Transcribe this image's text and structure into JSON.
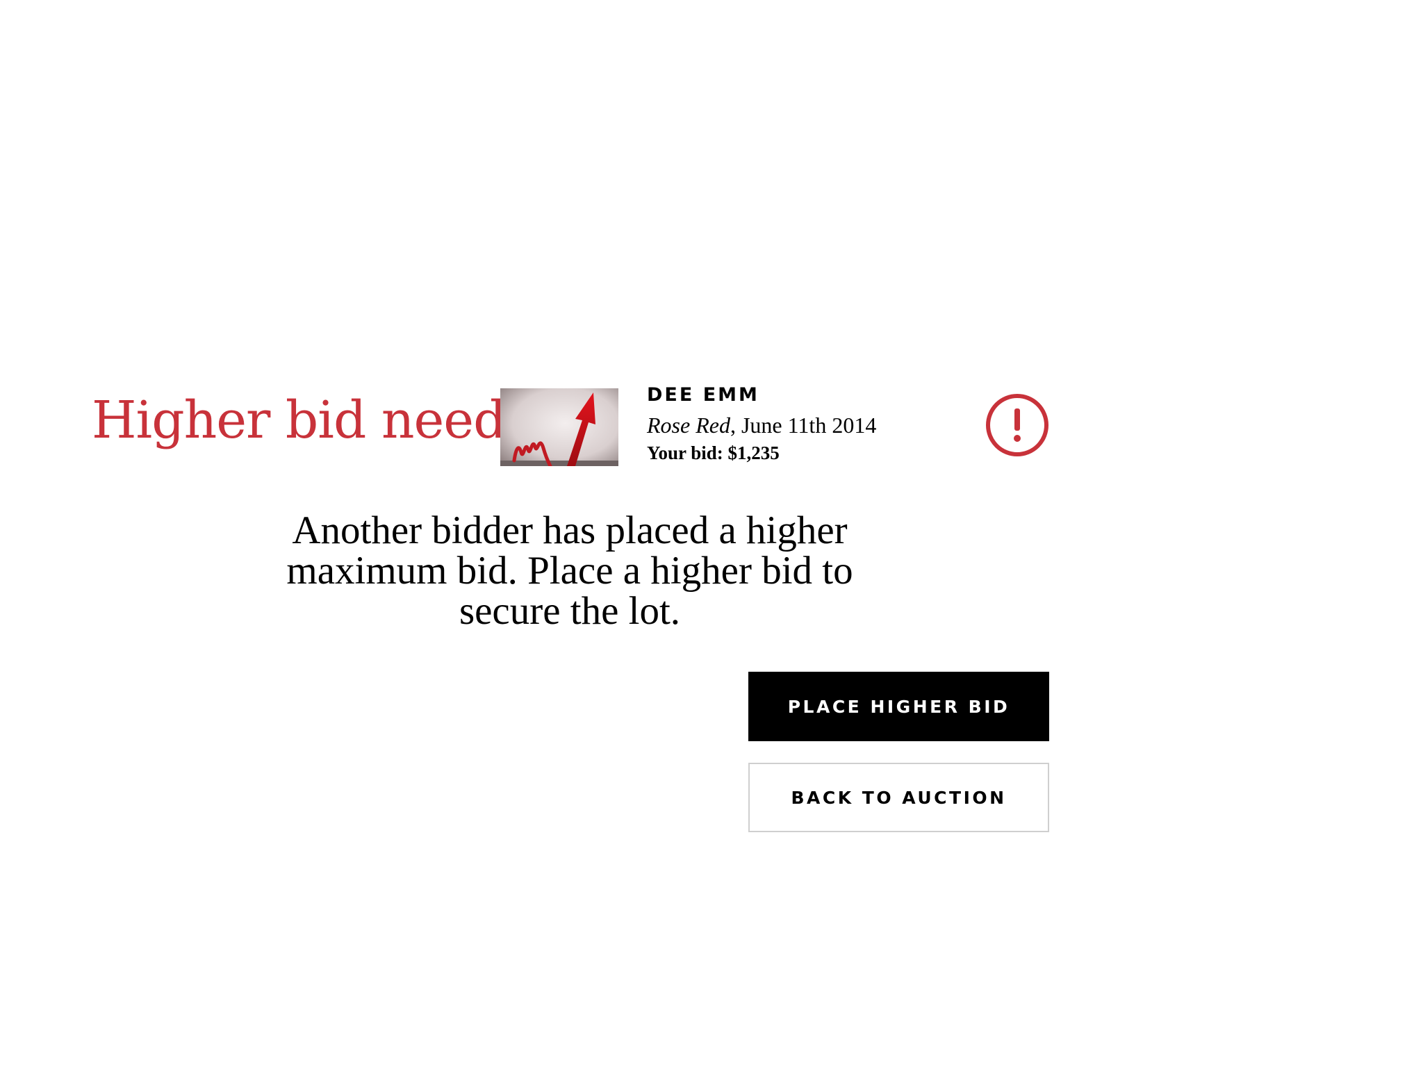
{
  "heading": "Higher bid needed",
  "lot": {
    "artist": "DEE EMM",
    "work_title": "Rose Red",
    "work_date": ", June 11th 2014",
    "your_bid": "Your bid: $1,235",
    "thumbnail": "red-arrow-rising-image"
  },
  "alert_icon": "exclamation-circle-icon",
  "message": "Another bidder has placed a higher maximum bid. Place a higher bid to secure the lot.",
  "actions": {
    "primary_label": "PLACE HIGHER BID",
    "secondary_label": "BACK TO AUCTION"
  },
  "colors": {
    "accent": "#c8323a",
    "primary_button": "#000000",
    "secondary_border": "#cfcfcf"
  }
}
